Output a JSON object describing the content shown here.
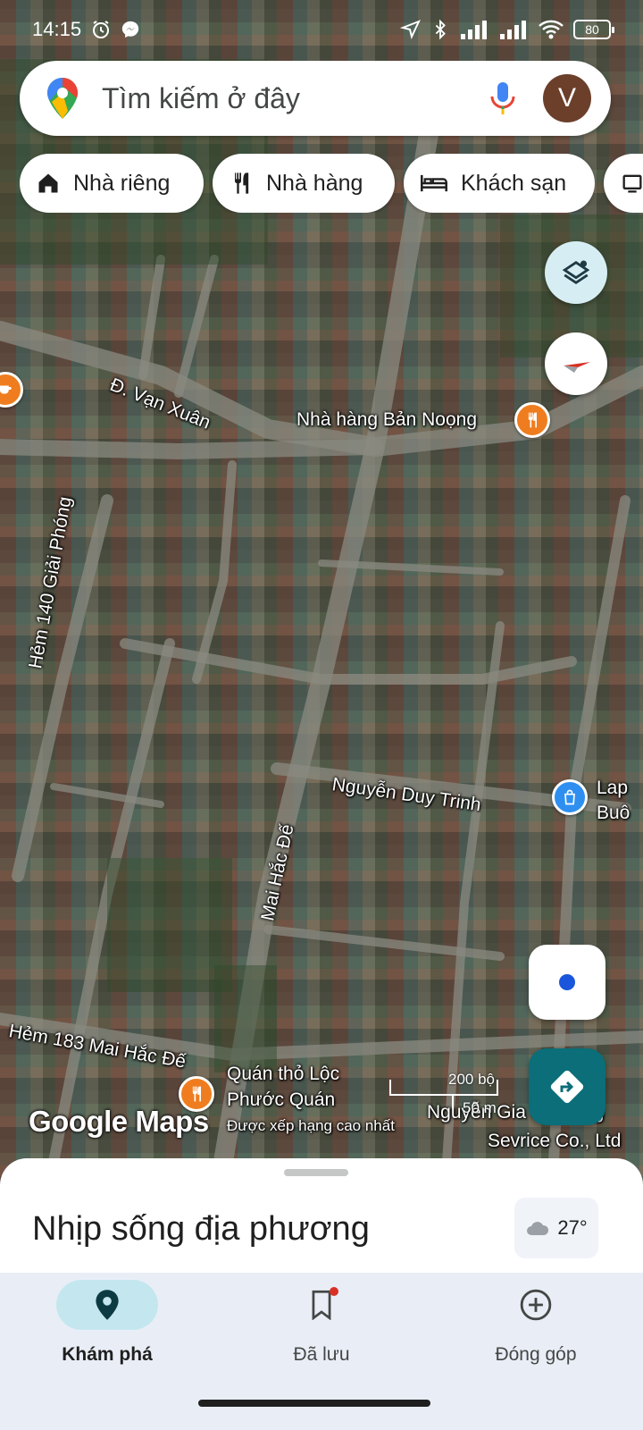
{
  "status_bar": {
    "time": "14:15",
    "battery": "80"
  },
  "search": {
    "placeholder": "Tìm kiếm ở đây",
    "avatar_letter": "V"
  },
  "chips": [
    {
      "label": "Nhà riêng",
      "icon": "home-icon"
    },
    {
      "label": "Nhà hàng",
      "icon": "restaurant-icon"
    },
    {
      "label": "Khách sạn",
      "icon": "hotel-icon"
    }
  ],
  "map": {
    "street_labels": {
      "van_xuan": "Đ. Vạn Xuân",
      "hem_140": "Hẻm 140 Giải Phóng",
      "nguyen_duy_trinh": "Nguyễn Duy Trinh",
      "mai_hac_de": "Mai Hắc Đế",
      "hem_183": "Hẻm 183 Mai Hắc Đế"
    },
    "poi": {
      "restaurant_ban_noong": "Nhà hàng Bản Noọng",
      "quan_tho_line1": "Quán thỏ Lộc",
      "quan_tho_line2": "Phước Quán",
      "quan_tho_sub": "Được xếp hạng cao nhất",
      "lap_line1": "Lap",
      "lap_line2": "Buô",
      "company_line1": "Nguyễn Gia Shipping",
      "company_line2": "Sevrice Co., Ltd"
    },
    "scale": {
      "top": "200 bộ",
      "bottom": "50 m"
    },
    "logo": "Google Maps"
  },
  "bottom_sheet": {
    "title": "Nhịp sống địa phương",
    "temperature": "27°"
  },
  "nav": [
    {
      "label": "Khám phá",
      "icon": "location-pin-icon",
      "active": true
    },
    {
      "label": "Đã lưu",
      "icon": "bookmark-icon",
      "active": false
    },
    {
      "label": "Đóng góp",
      "icon": "add-circle-icon",
      "active": false
    }
  ],
  "colors": {
    "teal_accent": "#0b6e79",
    "nav_active_bg": "#c4e7ef",
    "poi_orange": "#ef7d1f",
    "poi_blue": "#2f8ff0"
  }
}
